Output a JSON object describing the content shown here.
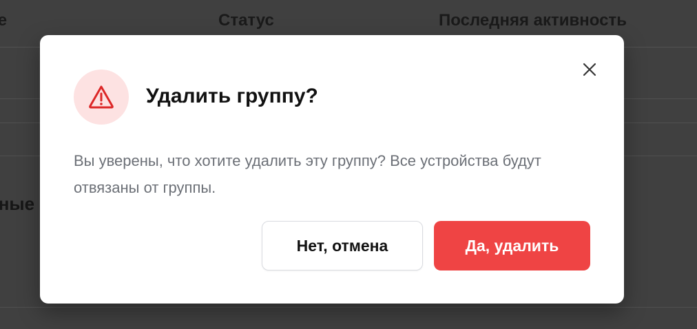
{
  "background": {
    "columns": {
      "name_partial": "ие",
      "status": "Статус",
      "last_activity": "Последняя активность"
    },
    "section_partial": "нные"
  },
  "dialog": {
    "title": "Удалить группу?",
    "message": "Вы уверены, что хотите удалить эту группу? Все устройства будут отвязаны от группы.",
    "cancel_label": "Нет, отмена",
    "confirm_label": "Да, удалить",
    "icon": "warning-triangle-icon",
    "close_icon": "close-icon"
  },
  "colors": {
    "danger": "#ef4444",
    "danger_bg": "#fde2e2",
    "overlay": "#404040"
  }
}
